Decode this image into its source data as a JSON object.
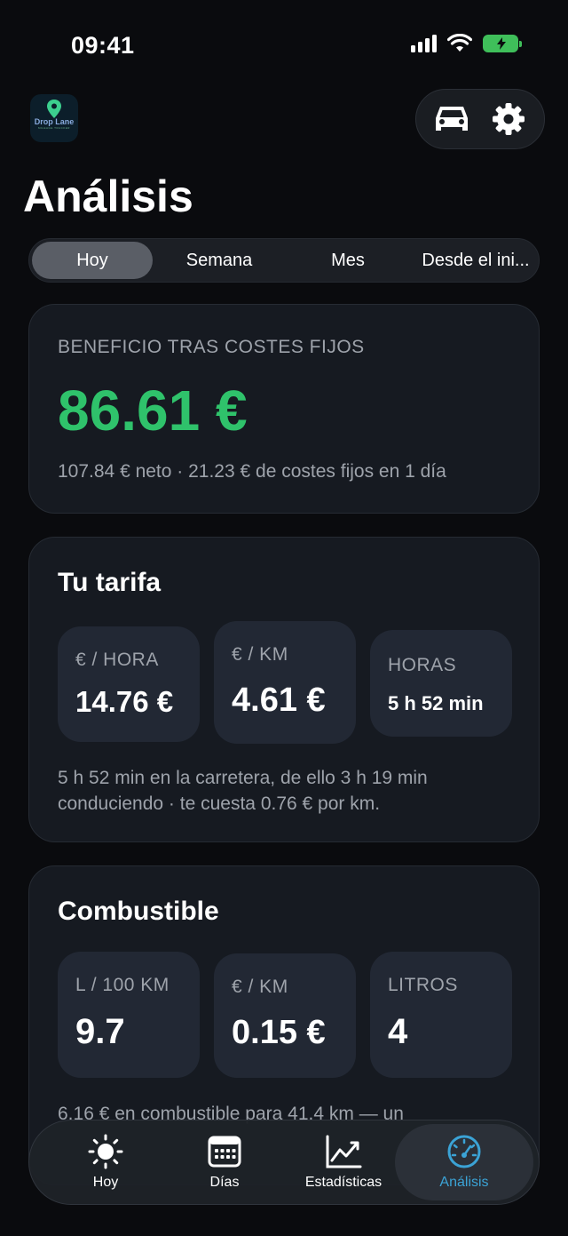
{
  "status_bar": {
    "time": "09:41"
  },
  "app": {
    "logo_text": "Drop Lane",
    "logo_subtext": "MILEAGE TRACKER"
  },
  "header": {
    "title": "Análisis"
  },
  "segments": [
    {
      "label": "Hoy",
      "active": true
    },
    {
      "label": "Semana",
      "active": false
    },
    {
      "label": "Mes",
      "active": false
    },
    {
      "label": "Desde el ini...",
      "active": false
    }
  ],
  "profit_card": {
    "label": "BENEFICIO TRAS COSTES FIJOS",
    "value": "86.61 €",
    "subtitle": "107.84 € neto · 21.23 € de costes fijos en 1 día"
  },
  "rate_card": {
    "title": "Tu tarifa",
    "tiles": [
      {
        "label": "€ / HORA",
        "value": "14.76 €"
      },
      {
        "label": "€ / KM",
        "value": "4.61 €"
      },
      {
        "label": "HORAS",
        "value": "5 h 52 min"
      }
    ],
    "description_line1": "5 h 52 min en la carretera, de ello 3 h 19 min",
    "description_line2": "conduciendo · te cuesta 0.76 € por km."
  },
  "fuel_card": {
    "title": "Combustible",
    "tiles": [
      {
        "label": "L / 100 KM",
        "value": "9.7"
      },
      {
        "label": "€ / KM",
        "value": "0.15 €"
      },
      {
        "label": "LITROS",
        "value": "4"
      }
    ],
    "description": "6.16 € en combustible para 41.4 km — un"
  },
  "tab_bar": {
    "items": [
      {
        "label": "Hoy",
        "icon": "sun-icon",
        "active": false
      },
      {
        "label": "Días",
        "icon": "calendar-icon",
        "active": false
      },
      {
        "label": "Estadísticas",
        "icon": "chart-icon",
        "active": false
      },
      {
        "label": "Análisis",
        "icon": "speedometer-icon",
        "active": true
      }
    ]
  },
  "colors": {
    "accent_green": "#2fc26b",
    "accent_blue": "#3ba3d6",
    "battery": "#3fbf5a"
  }
}
